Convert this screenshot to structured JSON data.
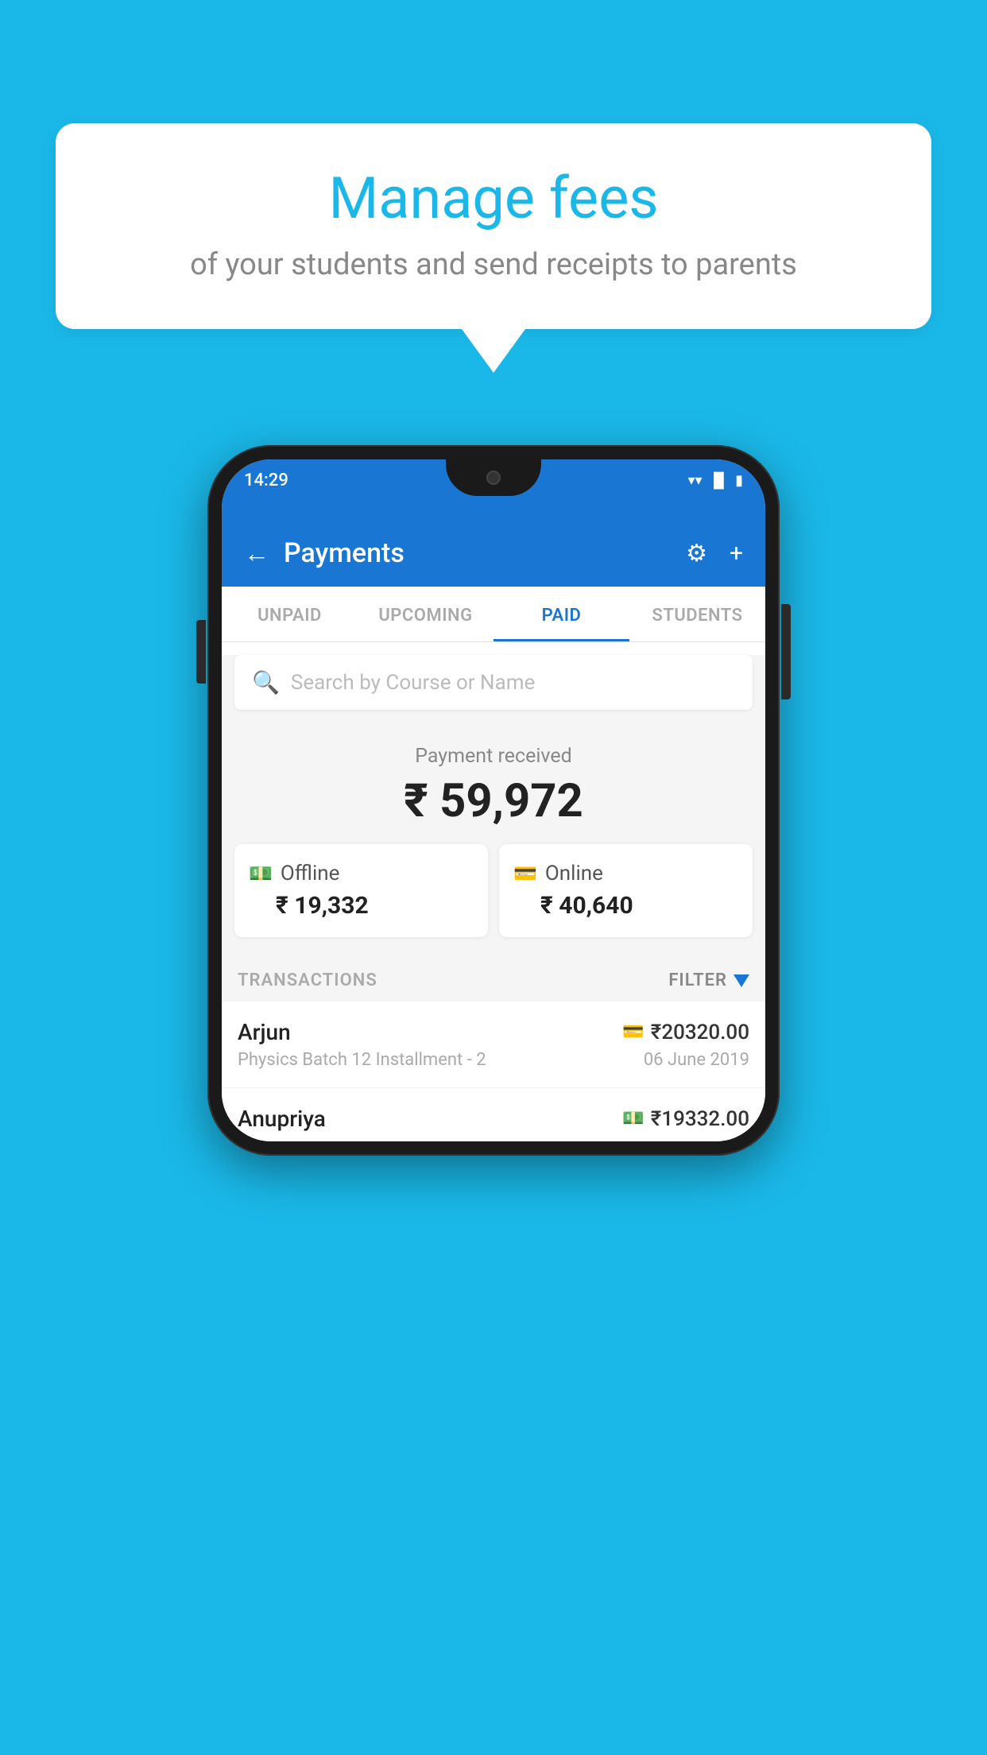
{
  "background_color": "#1ab8e8",
  "speech_bubble": {
    "title": "Manage fees",
    "subtitle": "of your students and send receipts to parents"
  },
  "phone": {
    "status_bar": {
      "time": "14:29"
    },
    "header": {
      "title": "Payments",
      "back_label": "←",
      "gear_label": "⚙",
      "plus_label": "+"
    },
    "tabs": [
      {
        "label": "UNPAID",
        "active": false
      },
      {
        "label": "UPCOMING",
        "active": false
      },
      {
        "label": "PAID",
        "active": true
      },
      {
        "label": "STUDENTS",
        "active": false
      }
    ],
    "search": {
      "placeholder": "Search by Course or Name"
    },
    "payment_summary": {
      "label": "Payment received",
      "amount": "₹ 59,972",
      "offline": {
        "label": "Offline",
        "amount": "₹ 19,332"
      },
      "online": {
        "label": "Online",
        "amount": "₹ 40,640"
      }
    },
    "transactions": {
      "header_label": "TRANSACTIONS",
      "filter_label": "FILTER",
      "items": [
        {
          "name": "Arjun",
          "course": "Physics Batch 12 Installment - 2",
          "amount": "₹20320.00",
          "date": "06 June 2019",
          "payment_type": "card"
        },
        {
          "name": "Anupriya",
          "course": "",
          "amount": "₹19332.00",
          "date": "",
          "payment_type": "cash"
        }
      ]
    }
  }
}
